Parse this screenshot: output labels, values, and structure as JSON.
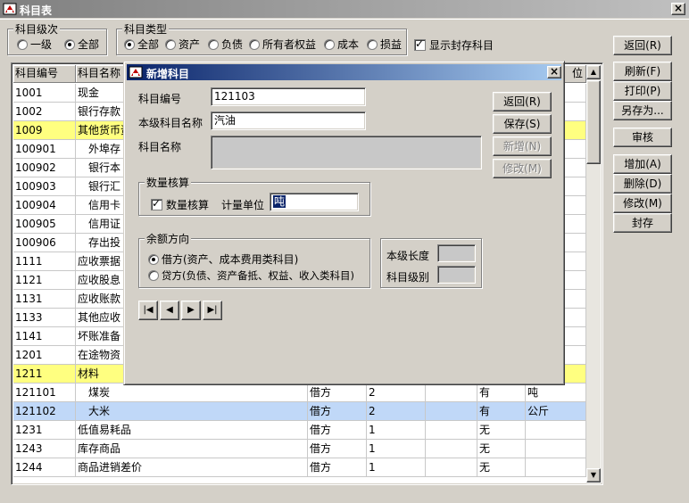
{
  "window": {
    "title": "科目表",
    "close": "×"
  },
  "level_group": {
    "legend": "科目级次",
    "options": [
      {
        "label": "一级",
        "checked": false
      },
      {
        "label": "全部",
        "checked": true
      }
    ]
  },
  "type_group": {
    "legend": "科目类型",
    "options": [
      {
        "label": "全部",
        "checked": true
      },
      {
        "label": "资产",
        "checked": false
      },
      {
        "label": "负债",
        "checked": false
      },
      {
        "label": "所有者权益",
        "checked": false
      },
      {
        "label": "成本",
        "checked": false
      },
      {
        "label": "损益",
        "checked": false
      }
    ]
  },
  "show_sealed": {
    "label": "显示封存科目",
    "checked": true
  },
  "side_buttons": [
    "返回(R)",
    "刷新(F)",
    "打印(P)",
    "另存为...",
    "审核",
    "增加(A)",
    "删除(D)",
    "修改(M)",
    "封存"
  ],
  "grid": {
    "headers": [
      "科目编号",
      "科目名称",
      "",
      "",
      "",
      "",
      ""
    ],
    "header_tail": "位",
    "rows": [
      {
        "code": "1001",
        "name": "现金",
        "dir": "",
        "len": "",
        "c5": "",
        "qty": "",
        "unit": "",
        "style": ""
      },
      {
        "code": "1002",
        "name": "银行存款",
        "dir": "",
        "len": "",
        "c5": "",
        "qty": "",
        "unit": "",
        "style": ""
      },
      {
        "code": "1009",
        "name": "其他货币资",
        "dir": "",
        "len": "",
        "c5": "",
        "qty": "",
        "unit": "",
        "style": "yellow"
      },
      {
        "code": "100901",
        "name": "外埠存",
        "dir": "",
        "len": "",
        "c5": "",
        "qty": "",
        "unit": "",
        "style": "",
        "indent": true
      },
      {
        "code": "100902",
        "name": "银行本",
        "dir": "",
        "len": "",
        "c5": "",
        "qty": "",
        "unit": "",
        "style": "",
        "indent": true
      },
      {
        "code": "100903",
        "name": "银行汇",
        "dir": "",
        "len": "",
        "c5": "",
        "qty": "",
        "unit": "",
        "style": "",
        "indent": true
      },
      {
        "code": "100904",
        "name": "信用卡",
        "dir": "",
        "len": "",
        "c5": "",
        "qty": "",
        "unit": "",
        "style": "",
        "indent": true
      },
      {
        "code": "100905",
        "name": "信用证",
        "dir": "",
        "len": "",
        "c5": "",
        "qty": "",
        "unit": "",
        "style": "",
        "indent": true
      },
      {
        "code": "100906",
        "name": "存出投",
        "dir": "",
        "len": "",
        "c5": "",
        "qty": "",
        "unit": "",
        "style": "",
        "indent": true
      },
      {
        "code": "1111",
        "name": "应收票据",
        "dir": "",
        "len": "",
        "c5": "",
        "qty": "",
        "unit": "",
        "style": ""
      },
      {
        "code": "1121",
        "name": "应收股息",
        "dir": "",
        "len": "",
        "c5": "",
        "qty": "",
        "unit": "",
        "style": ""
      },
      {
        "code": "1131",
        "name": "应收账款",
        "dir": "",
        "len": "",
        "c5": "",
        "qty": "",
        "unit": "",
        "style": ""
      },
      {
        "code": "1133",
        "name": "其他应收",
        "dir": "",
        "len": "",
        "c5": "",
        "qty": "",
        "unit": "",
        "style": ""
      },
      {
        "code": "1141",
        "name": "坏账准备",
        "dir": "",
        "len": "",
        "c5": "",
        "qty": "",
        "unit": "",
        "style": ""
      },
      {
        "code": "1201",
        "name": "在途物资",
        "dir": "",
        "len": "",
        "c5": "",
        "qty": "",
        "unit": "",
        "style": ""
      },
      {
        "code": "1211",
        "name": "材料",
        "dir": "",
        "len": "",
        "c5": "",
        "qty": "",
        "unit": "",
        "style": "yellow"
      },
      {
        "code": "121101",
        "name": "煤炭",
        "dir": "借方",
        "len": "2",
        "c5": "",
        "qty": "有",
        "unit": "吨",
        "style": "",
        "indent": true
      },
      {
        "code": "121102",
        "name": "大米",
        "dir": "借方",
        "len": "2",
        "c5": "",
        "qty": "有",
        "unit": "公斤",
        "style": "selected",
        "indent": true
      },
      {
        "code": "1231",
        "name": "低值易耗品",
        "dir": "借方",
        "len": "1",
        "c5": "",
        "qty": "无",
        "unit": "",
        "style": ""
      },
      {
        "code": "1243",
        "name": "库存商品",
        "dir": "借方",
        "len": "1",
        "c5": "",
        "qty": "无",
        "unit": "",
        "style": ""
      },
      {
        "code": "1244",
        "name": "商品进销差价",
        "dir": "借方",
        "len": "1",
        "c5": "",
        "qty": "无",
        "unit": "",
        "style": ""
      }
    ]
  },
  "dialog": {
    "title": "新增科目",
    "code_label": "科目编号",
    "code_value": "121103",
    "local_name_label": "本级科目名称",
    "local_name_value": "汽油",
    "full_name_label": "科目名称",
    "full_name_value": "",
    "buttons": [
      {
        "label": "返回(R)",
        "disabled": false
      },
      {
        "label": "保存(S)",
        "disabled": false
      },
      {
        "label": "新增(N)",
        "disabled": true
      },
      {
        "label": "修改(M)",
        "disabled": true
      }
    ],
    "qty_group": {
      "legend": "数量核算",
      "check_label": "数量核算",
      "checked": true,
      "unit_label": "计量单位",
      "unit_value": "吨"
    },
    "balance_group": {
      "legend": "余额方向",
      "options": [
        {
          "label": "借方(资产、成本费用类科目)",
          "checked": true
        },
        {
          "label": "贷方(负债、资产备抵、权益、收入类科目)",
          "checked": false
        }
      ]
    },
    "info": {
      "length_label": "本级长度",
      "length_value": "",
      "level_label": "科目级别",
      "level_value": ""
    },
    "nav": [
      "first",
      "prev",
      "next",
      "last"
    ]
  }
}
